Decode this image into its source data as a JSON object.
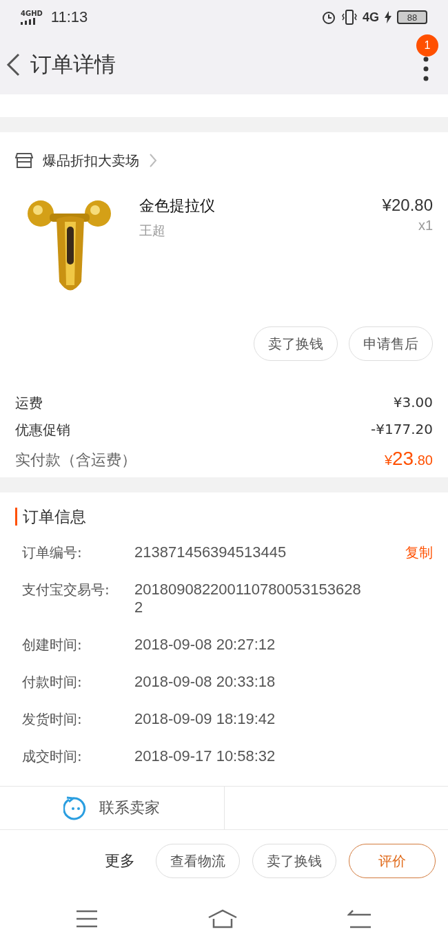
{
  "status_bar": {
    "network_badge": "4GHD",
    "time": "11:13",
    "network": "4G",
    "battery": "88"
  },
  "header": {
    "title": "订单详情",
    "badge": "1"
  },
  "shop": {
    "name": "爆品折扣大卖场",
    "item": {
      "title": "金色提拉仪",
      "spec": "王超",
      "price": "¥20.80",
      "quantity": "x1"
    },
    "buttons": [
      "卖了换钱",
      "申请售后"
    ]
  },
  "fees": [
    {
      "label": "运费",
      "value": "¥3.00"
    },
    {
      "label": "优惠促销",
      "value": "-¥177.20"
    }
  ],
  "total": {
    "label": "实付款（含运费）",
    "symbol": "¥",
    "integer": "23",
    "decimal": ".80"
  },
  "order_info": {
    "title": "订单信息",
    "rows": [
      {
        "label": "订单编号:",
        "value": "213871456394513445",
        "action": "复制"
      },
      {
        "label": "支付宝交易号:",
        "value": "2018090822001107800531536282"
      },
      {
        "label": "创建时间:",
        "value": "2018-09-08 20:27:12"
      },
      {
        "label": "付款时间:",
        "value": "2018-09-08 20:33:18"
      },
      {
        "label": "发货时间:",
        "value": "2018-09-09 18:19:42"
      },
      {
        "label": "成交时间:",
        "value": "2018-09-17 10:58:32"
      }
    ]
  },
  "contact": {
    "label": "联系卖家"
  },
  "actions": {
    "more": "更多",
    "buttons": [
      {
        "label": "查看物流",
        "kind": "plain"
      },
      {
        "label": "卖了换钱",
        "kind": "plain"
      },
      {
        "label": "评价",
        "kind": "primary"
      }
    ]
  }
}
